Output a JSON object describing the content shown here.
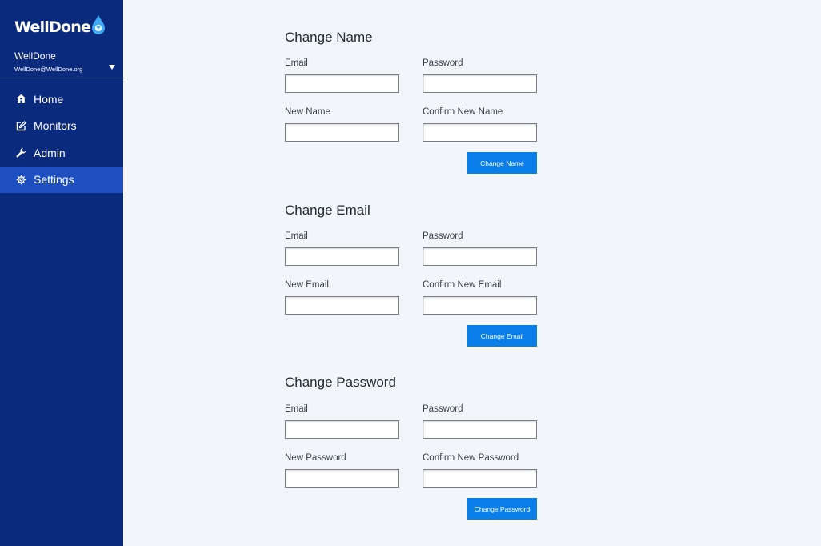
{
  "sidebar": {
    "brand": "WellDone",
    "account": {
      "name": "WellDone",
      "email": "WellDone@WellDone.org"
    },
    "nav": [
      {
        "label": "Home",
        "icon": "home-icon",
        "active": false
      },
      {
        "label": "Monitors",
        "icon": "edit-icon",
        "active": false
      },
      {
        "label": "Admin",
        "icon": "wrench-icon",
        "active": false
      },
      {
        "label": "Settings",
        "icon": "gear-icon",
        "active": true
      }
    ]
  },
  "sections": {
    "name": {
      "title": "Change Name",
      "email_label": "Email",
      "password_label": "Password",
      "new_label": "New Name",
      "confirm_label": "Confirm New Name",
      "email_value": "",
      "password_value": "",
      "new_value": "",
      "confirm_value": "",
      "button": "Change Name"
    },
    "email": {
      "title": "Change Email",
      "email_label": "Email",
      "password_label": "Password",
      "new_label": "New Email",
      "confirm_label": "Confirm New Email",
      "email_value": "",
      "password_value": "",
      "new_value": "",
      "confirm_value": "",
      "button": "Change Email"
    },
    "password": {
      "title": "Change Password",
      "email_label": "Email",
      "password_label": "Password",
      "new_label": "New Password",
      "confirm_label": "Confirm New Password",
      "email_value": "",
      "password_value": "",
      "new_value": "",
      "confirm_value": "",
      "button": "Change Password"
    }
  },
  "colors": {
    "sidebar_bg": "#0a2a7e",
    "sidebar_active": "#1e4fc1",
    "page_bg": "#f2f6fa",
    "button_bg": "#0a7ee8",
    "brand_drop": "#3fa9f5"
  }
}
